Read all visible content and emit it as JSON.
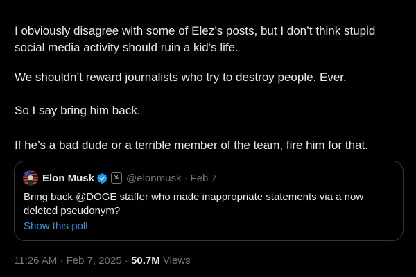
{
  "tweet": {
    "paragraphs": [
      "I obviously disagree with some of Elez’s posts, but I don’t think stupid\nsocial media activity should ruin a kid’s life.",
      "We shouldn’t reward journalists who try to destroy people. Ever.",
      "So I say bring him back.",
      "If he’s a bad dude or a terrible member of the team, fire him for that."
    ],
    "meta": {
      "time": "11:26 AM",
      "separator": "·",
      "date": "Feb 7, 2025",
      "views_count": "50.7M",
      "views_label": "Views"
    }
  },
  "quoted_tweet": {
    "author_name": "Elon Musk",
    "handle": "@elonmusk",
    "separator": "·",
    "date": "Feb 7",
    "affiliate_badge": "𝕏",
    "text": "Bring back @DOGE staffer who made inappropriate statements via a now deleted pseudonym?",
    "poll_link": "Show this poll"
  },
  "icons": {
    "avatar": "profile-avatar",
    "verified": "verified-badge-icon",
    "affiliate": "x-logo-icon"
  },
  "colors": {
    "background": "#000000",
    "text": "#e7e9ea",
    "muted": "#71767b",
    "link": "#1d9bf0",
    "border": "#333639"
  }
}
